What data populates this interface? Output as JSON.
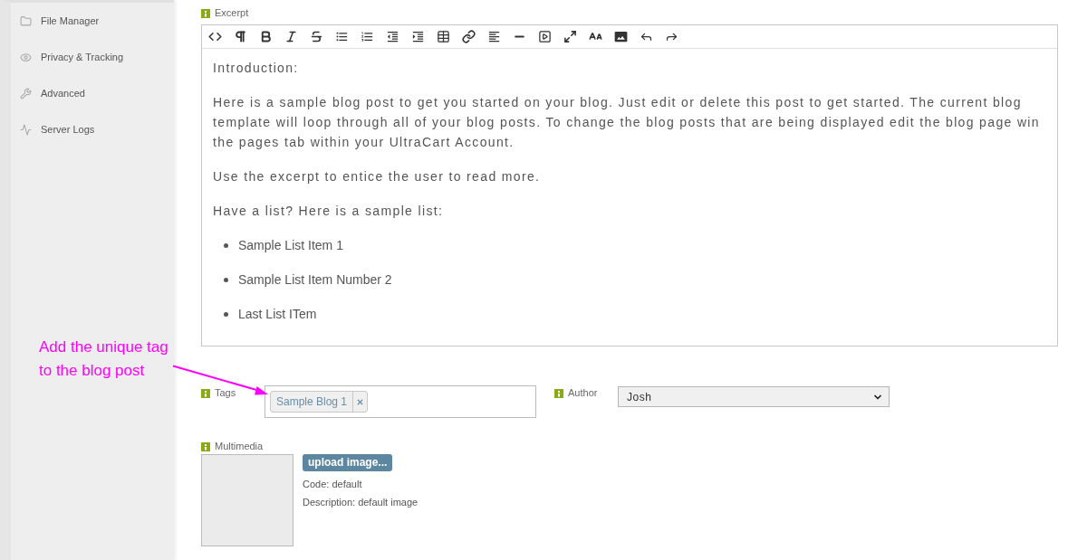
{
  "sidebar": {
    "items": [
      {
        "label": "File Manager"
      },
      {
        "label": "Privacy & Tracking"
      },
      {
        "label": "Advanced"
      },
      {
        "label": "Server Logs"
      }
    ]
  },
  "excerpt": {
    "label": "Excerpt",
    "content": [
      {
        "kind": "paragraph",
        "text": "Introduction:"
      },
      {
        "kind": "paragraph",
        "text": "Here is a sample blog post to get you started on your blog. Just edit or delete this post to get started. The current blog template will loop through all of your blog posts. To change the blog posts that are being displayed edit the blog page win the pages tab within your UltraCart Account."
      },
      {
        "kind": "paragraph",
        "text": "Use the excerpt to entice the user to read more."
      },
      {
        "kind": "paragraph",
        "text": "Have a list? Here is a sample list:"
      },
      {
        "kind": "list",
        "items": [
          "Sample List Item 1",
          "Sample List Item Number 2",
          "Last List ITem"
        ]
      }
    ]
  },
  "tags": {
    "label": "Tags",
    "chips": [
      {
        "text": "Sample Blog 1"
      }
    ]
  },
  "author": {
    "label": "Author",
    "value": "Josh"
  },
  "multimedia": {
    "label": "Multimedia",
    "button": "upload image...",
    "code": "Code: default",
    "description": "Description: default image"
  },
  "annotation": {
    "lines": [
      "Add the unique tag",
      "to the blog post"
    ]
  }
}
